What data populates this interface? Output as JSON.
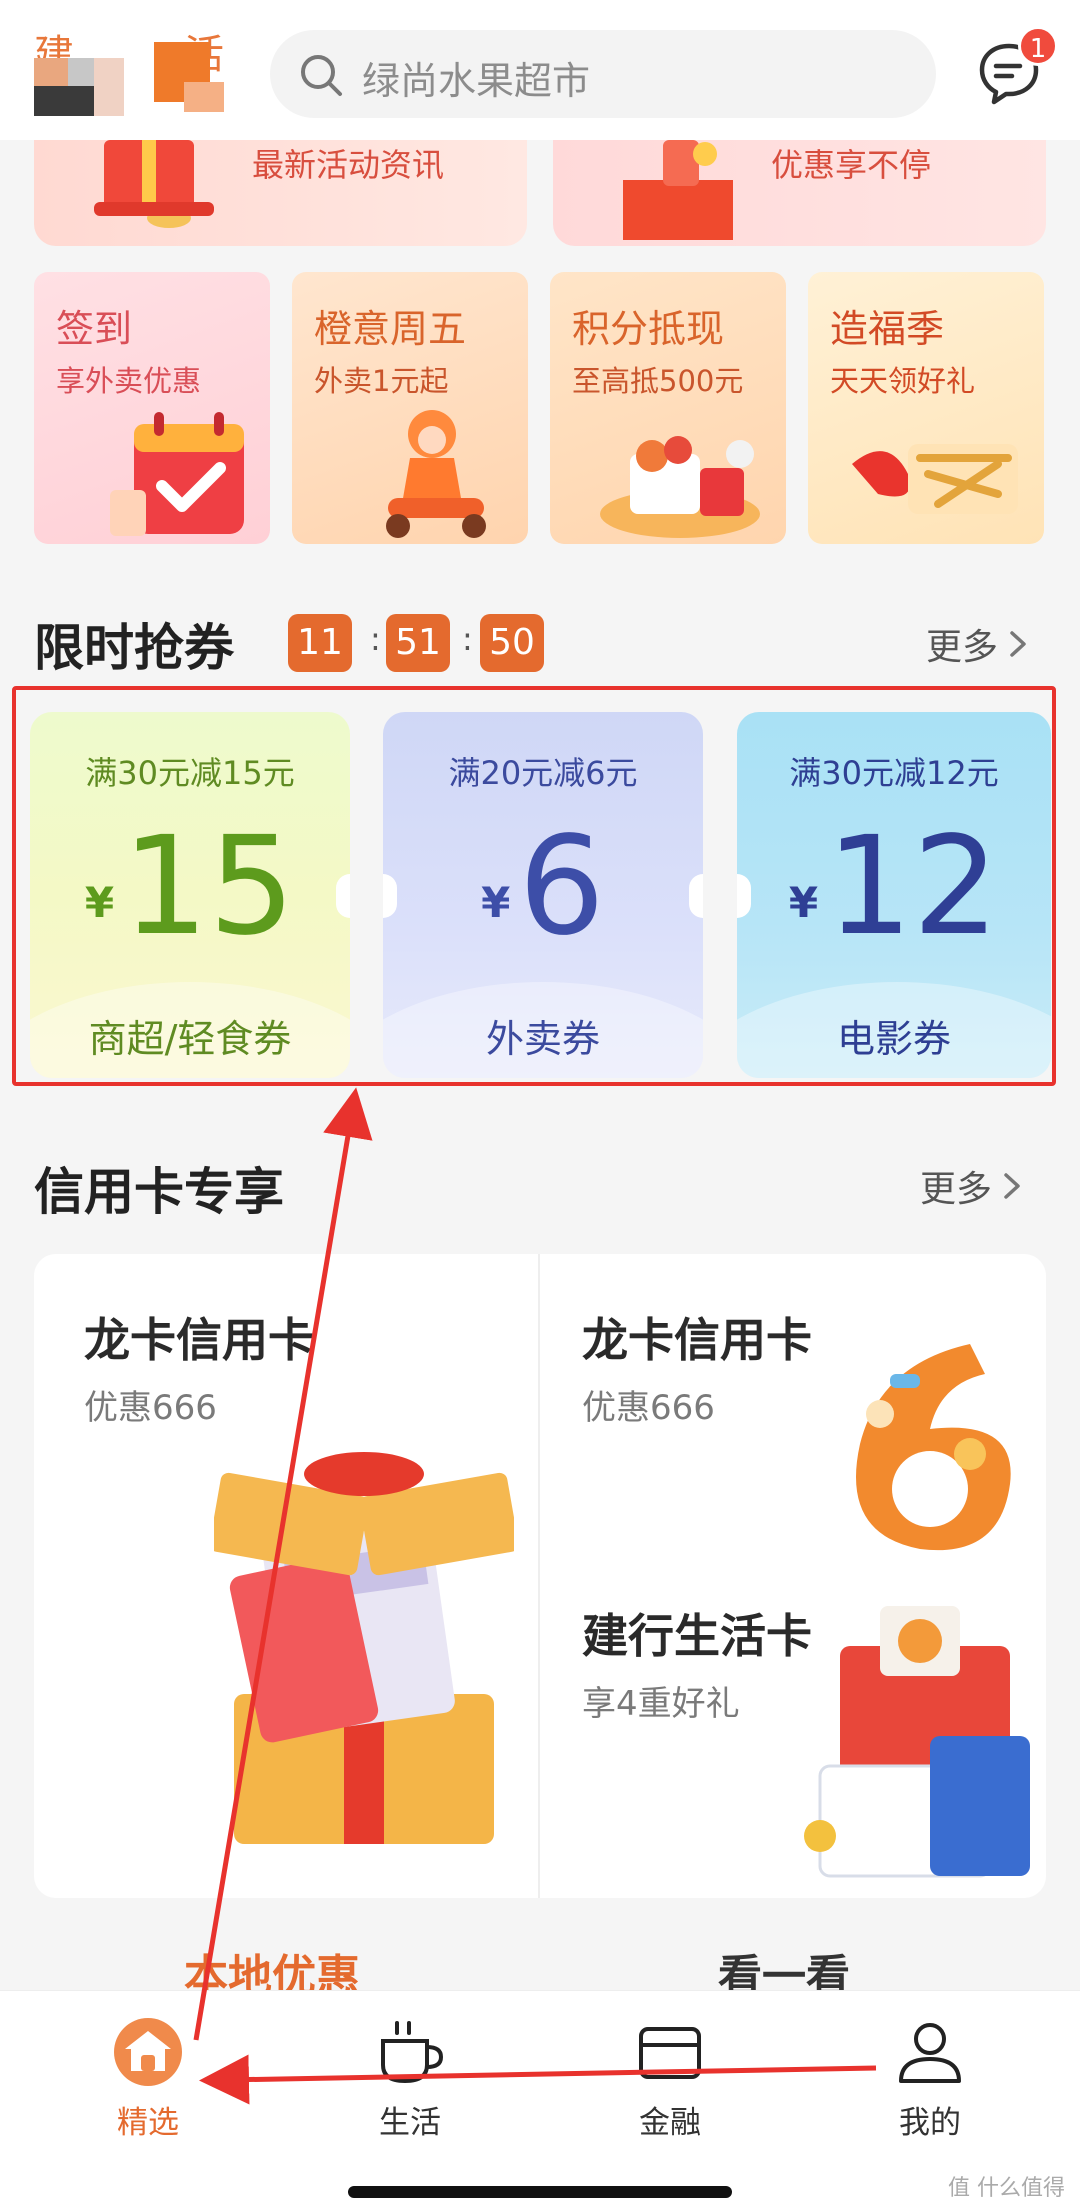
{
  "header": {
    "logo_text_left": "建",
    "logo_text_right": "活",
    "search_placeholder": "绿尚水果超市",
    "message_badge": "1"
  },
  "banners": [
    {
      "label": "最新活动资讯"
    },
    {
      "label": "优惠享不停"
    }
  ],
  "tiles": [
    {
      "title": "签到",
      "subtitle": "享外卖优惠"
    },
    {
      "title": "橙意周五",
      "subtitle": "外卖1元起"
    },
    {
      "title": "积分抵现",
      "subtitle": "至高抵500元"
    },
    {
      "title": "造福季",
      "subtitle": "天天领好礼"
    }
  ],
  "flash": {
    "title": "限时抢券",
    "countdown": {
      "h": "11",
      "m": "51",
      "s": "50"
    },
    "more": "更多",
    "coupons": [
      {
        "condition": "满30元减15元",
        "yen": "¥",
        "amount": "15",
        "type": "商超/轻食券"
      },
      {
        "condition": "满20元减6元",
        "yen": "¥",
        "amount": "6",
        "type": "外卖券"
      },
      {
        "condition": "满30元减12元",
        "yen": "¥",
        "amount": "12",
        "type": "电影券"
      }
    ]
  },
  "credit": {
    "title": "信用卡专享",
    "more": "更多",
    "cards": [
      {
        "title": "龙卡信用卡",
        "subtitle": "优惠666"
      },
      {
        "title": "龙卡信用卡",
        "subtitle": "优惠666"
      },
      {
        "title": "建行生活卡",
        "subtitle": "享4重好礼"
      }
    ]
  },
  "peek_tabs": {
    "left": "本地优惠",
    "right": "看一看"
  },
  "nav": [
    {
      "label": "精选",
      "icon": "home-icon",
      "active": true
    },
    {
      "label": "生活",
      "icon": "cup-icon",
      "active": false
    },
    {
      "label": "金融",
      "icon": "card-icon",
      "active": false
    },
    {
      "label": "我的",
      "icon": "user-icon",
      "active": false
    }
  ],
  "watermark": "值 什么值得买",
  "colors": {
    "accent": "#e46a2e",
    "highlight_box": "#e8322d"
  }
}
